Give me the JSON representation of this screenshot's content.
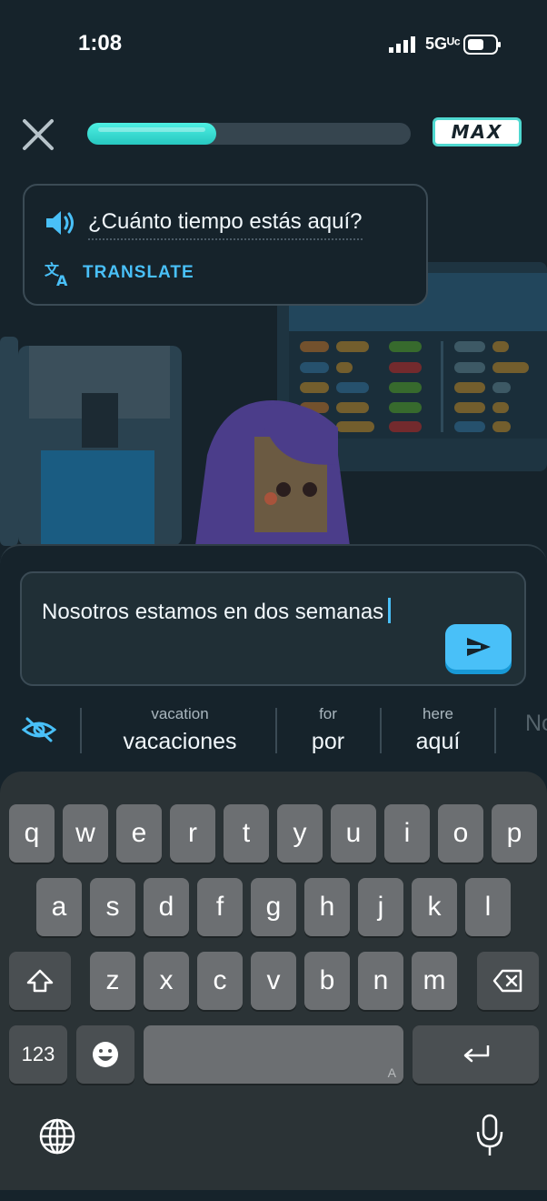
{
  "status_bar": {
    "time": "1:08",
    "network": "5Gᵁᶜ"
  },
  "header": {
    "progress": 0.4,
    "badge": "MAX"
  },
  "prompt": {
    "text": "¿Cuánto tiempo estás aquí?",
    "translate_label": "TRANSLATE"
  },
  "answer": {
    "text": "Nosotros estamos en dos semanas"
  },
  "suggestions": [
    {
      "hint": "vacation",
      "word": "vacaciones"
    },
    {
      "hint": "for",
      "word": "por"
    },
    {
      "hint": "here",
      "word": "aquí"
    },
    {
      "hint": "",
      "word": "No"
    }
  ],
  "keyboard": {
    "row1": [
      "q",
      "w",
      "e",
      "r",
      "t",
      "y",
      "u",
      "i",
      "o",
      "p"
    ],
    "row2": [
      "a",
      "s",
      "d",
      "f",
      "g",
      "h",
      "j",
      "k",
      "l"
    ],
    "row3": [
      "z",
      "x",
      "c",
      "v",
      "b",
      "n",
      "m"
    ],
    "numbers_label": "123",
    "space_hint": "A"
  },
  "colors": {
    "accent": "#49c0f8",
    "progress": "#4ef0e3",
    "background": "#16232b"
  }
}
